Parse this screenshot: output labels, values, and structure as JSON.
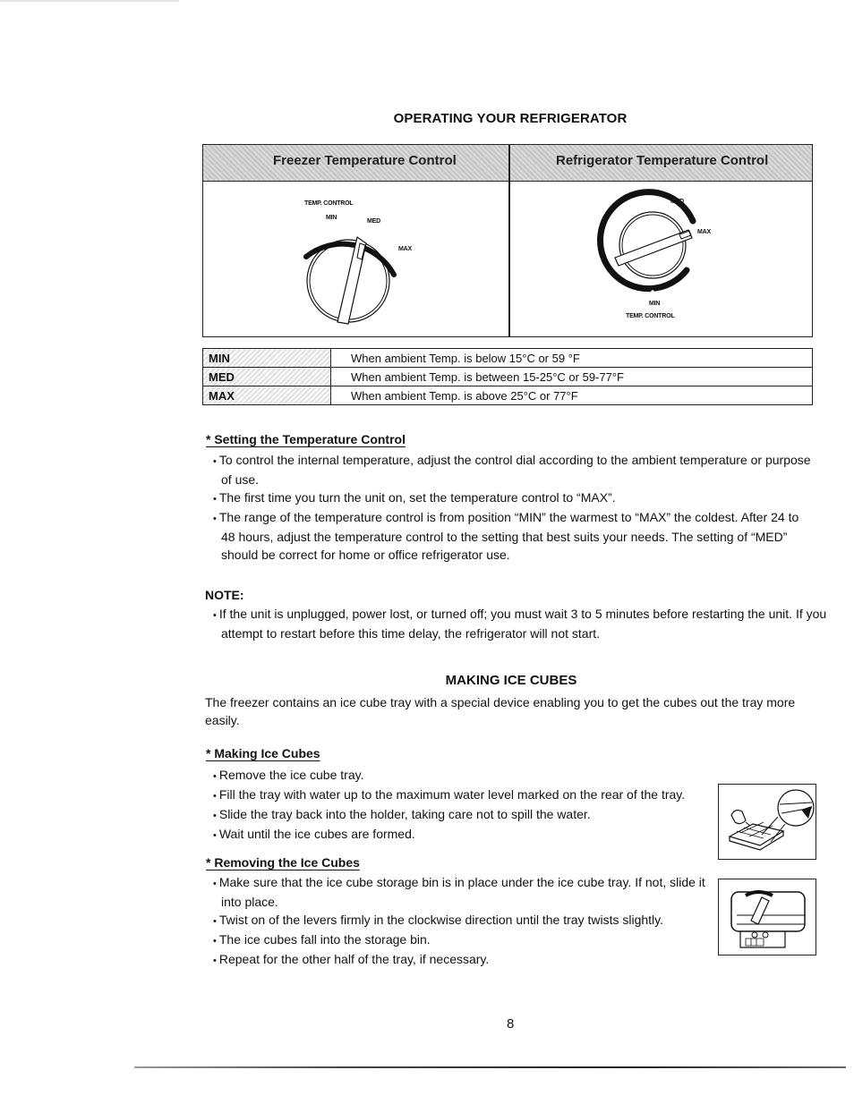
{
  "page": {
    "title": "OPERATING YOUR REFRIGERATOR",
    "page_number": "8"
  },
  "controls_table": {
    "freezer_header": "Freezer Temperature Control",
    "refrigerator_header": "Refrigerator Temperature Control",
    "freezer_dial": {
      "caption": "TEMP. CONTROL",
      "min": "MIN",
      "med": "MED",
      "max": "MAX"
    },
    "refrigerator_dial": {
      "caption": "TEMP. CONTROL",
      "min": "MIN",
      "med": "MED",
      "max": "MAX"
    }
  },
  "settings_table": {
    "rows": [
      {
        "setting": "MIN",
        "description": "When ambient Temp. is below 15°C or 59 °F"
      },
      {
        "setting": "MED",
        "description": "When ambient Temp. is between 15-25°C or 59-77°F"
      },
      {
        "setting": "MAX",
        "description": "When ambient Temp. is above 25°C or 77°F"
      }
    ]
  },
  "setting_section": {
    "heading": "* Setting the Temperature Control",
    "bullets": [
      "To control the internal temperature, adjust the control dial according to the ambient temperature or purpose of use.",
      "The first time you turn the unit on, set the temperature control to “MAX”.",
      "The range of the temperature control is from position “MIN” the warmest to “MAX” the coldest. After 24 to 48 hours, adjust the temperature control to the setting that best suits your needs. The setting of “MED” should be correct for home or office refrigerator use."
    ]
  },
  "note": {
    "heading": "NOTE:",
    "bullets": [
      "If the unit is unplugged, power lost, or turned off; you must wait 3 to 5 minutes before restarting the unit. If you attempt to restart before this time delay, the refrigerator will not start."
    ]
  },
  "ice_section": {
    "title": "MAKING ICE CUBES",
    "intro": "The freezer contains an ice cube tray with a special device enabling you to get the cubes out the tray more easily.",
    "making": {
      "heading": "* Making Ice Cubes",
      "bullets": [
        "Remove the ice cube tray.",
        "Fill the tray with water up to the maximum water level marked on the rear of the tray.",
        "Slide the tray back into the holder, taking care not to spill the water.",
        "Wait until the ice cubes are formed."
      ]
    },
    "removing": {
      "heading": "* Removing the Ice Cubes",
      "bullets": [
        "Make sure that the ice cube storage bin is in place under the ice cube tray. If not, slide it into place.",
        "Twist on of the levers firmly in the clockwise direction until the tray twists slightly.",
        "The ice cubes fall into the storage bin.",
        "Repeat for the other half of the tray, if necessary."
      ]
    }
  }
}
